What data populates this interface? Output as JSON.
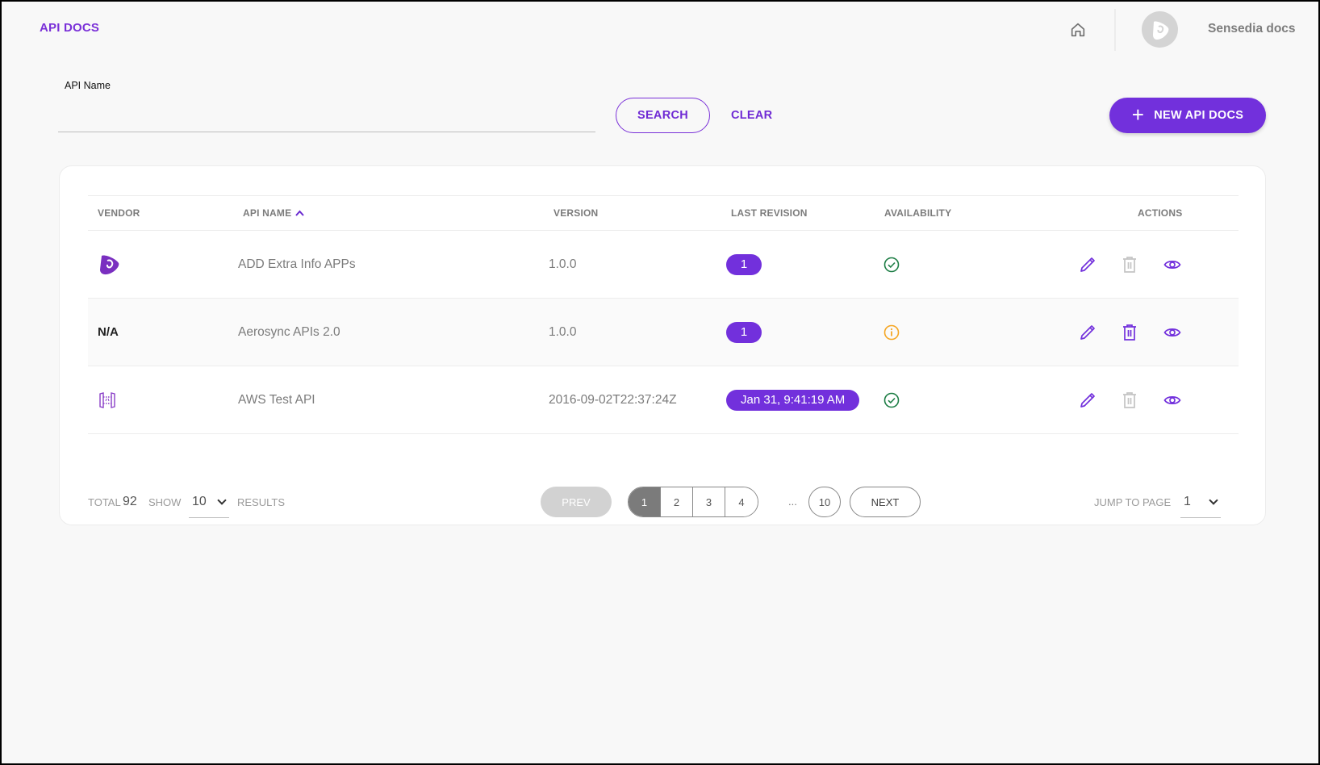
{
  "header": {
    "title": "API DOCS",
    "home_icon": "home-icon",
    "user_name": "Sensedia docs"
  },
  "search": {
    "label": "API Name",
    "value": "",
    "placeholder": "",
    "search_label": "SEARCH",
    "clear_label": "CLEAR",
    "new_label": "NEW API DOCS"
  },
  "colors": {
    "accent": "#7230dc",
    "success": "#1e7e46",
    "warning": "#f5a623"
  },
  "table": {
    "columns": {
      "vendor": "VENDOR",
      "api_name": "API NAME",
      "version": "VERSION",
      "last_revision": "LAST REVISION",
      "availability": "AVAILABILITY",
      "actions": "ACTIONS"
    },
    "sort": {
      "column": "api_name",
      "direction": "asc"
    },
    "rows": [
      {
        "vendor": "sensedia-logo",
        "vendor_text": "",
        "api_name": "ADD Extra Info APPs",
        "version": "1.0.0",
        "last_revision": "1",
        "availability": "available",
        "delete_enabled": false
      },
      {
        "vendor": "none",
        "vendor_text": "N/A",
        "api_name": "Aerosync APIs 2.0",
        "version": "1.0.0",
        "last_revision": "1",
        "availability": "warning",
        "delete_enabled": true
      },
      {
        "vendor": "aws-api-gateway",
        "vendor_text": "",
        "api_name": "AWS Test API",
        "version": "2016-09-02T22:37:24Z",
        "last_revision": "Jan 31, 9:41:19 AM",
        "availability": "available",
        "delete_enabled": false
      }
    ]
  },
  "footer": {
    "total_label": "TOTAL",
    "total": "92",
    "show_label": "SHOW",
    "page_size": "10",
    "results_label": "RESULTS",
    "prev_label": "PREV",
    "next_label": "NEXT",
    "pages": [
      "1",
      "2",
      "3",
      "4"
    ],
    "ellipsis": "...",
    "last_page": "10",
    "current_page": "1",
    "jump_label": "JUMP TO PAGE",
    "jump_value": "1"
  }
}
